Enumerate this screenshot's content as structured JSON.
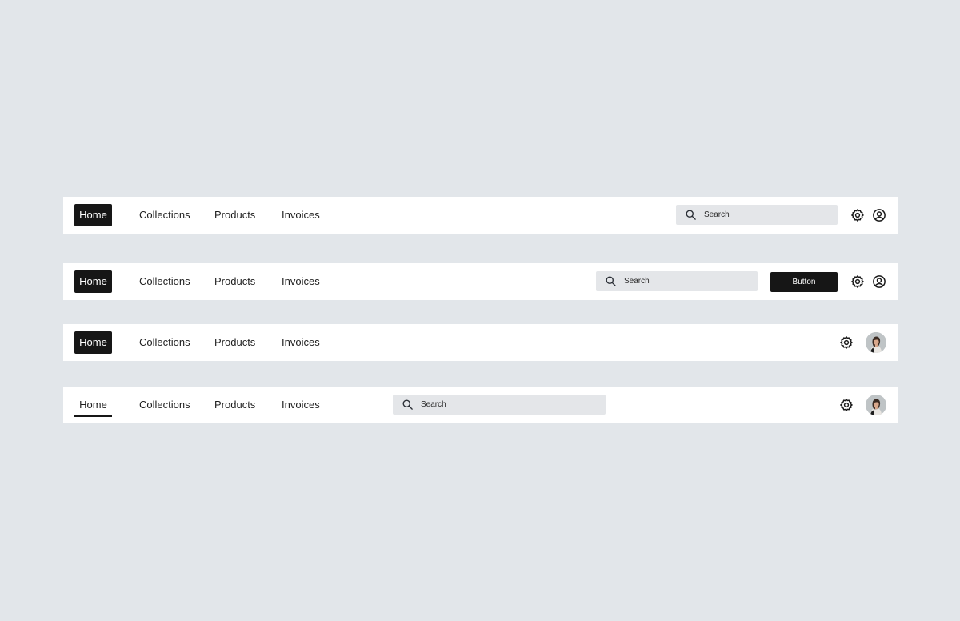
{
  "nav_items": {
    "home": "Home",
    "collections": "Collections",
    "products": "Products",
    "invoices": "Invoices"
  },
  "search": {
    "placeholder": "Search",
    "icon": "search-icon"
  },
  "button_label": "Button",
  "icons": {
    "settings": "gear-icon",
    "user": "user-circle-icon",
    "avatar": "avatar"
  },
  "colors": {
    "background": "#E2E6EA",
    "navbar": "#FFFFFF",
    "active": "#161616",
    "search_field": "#E4E6E9"
  }
}
